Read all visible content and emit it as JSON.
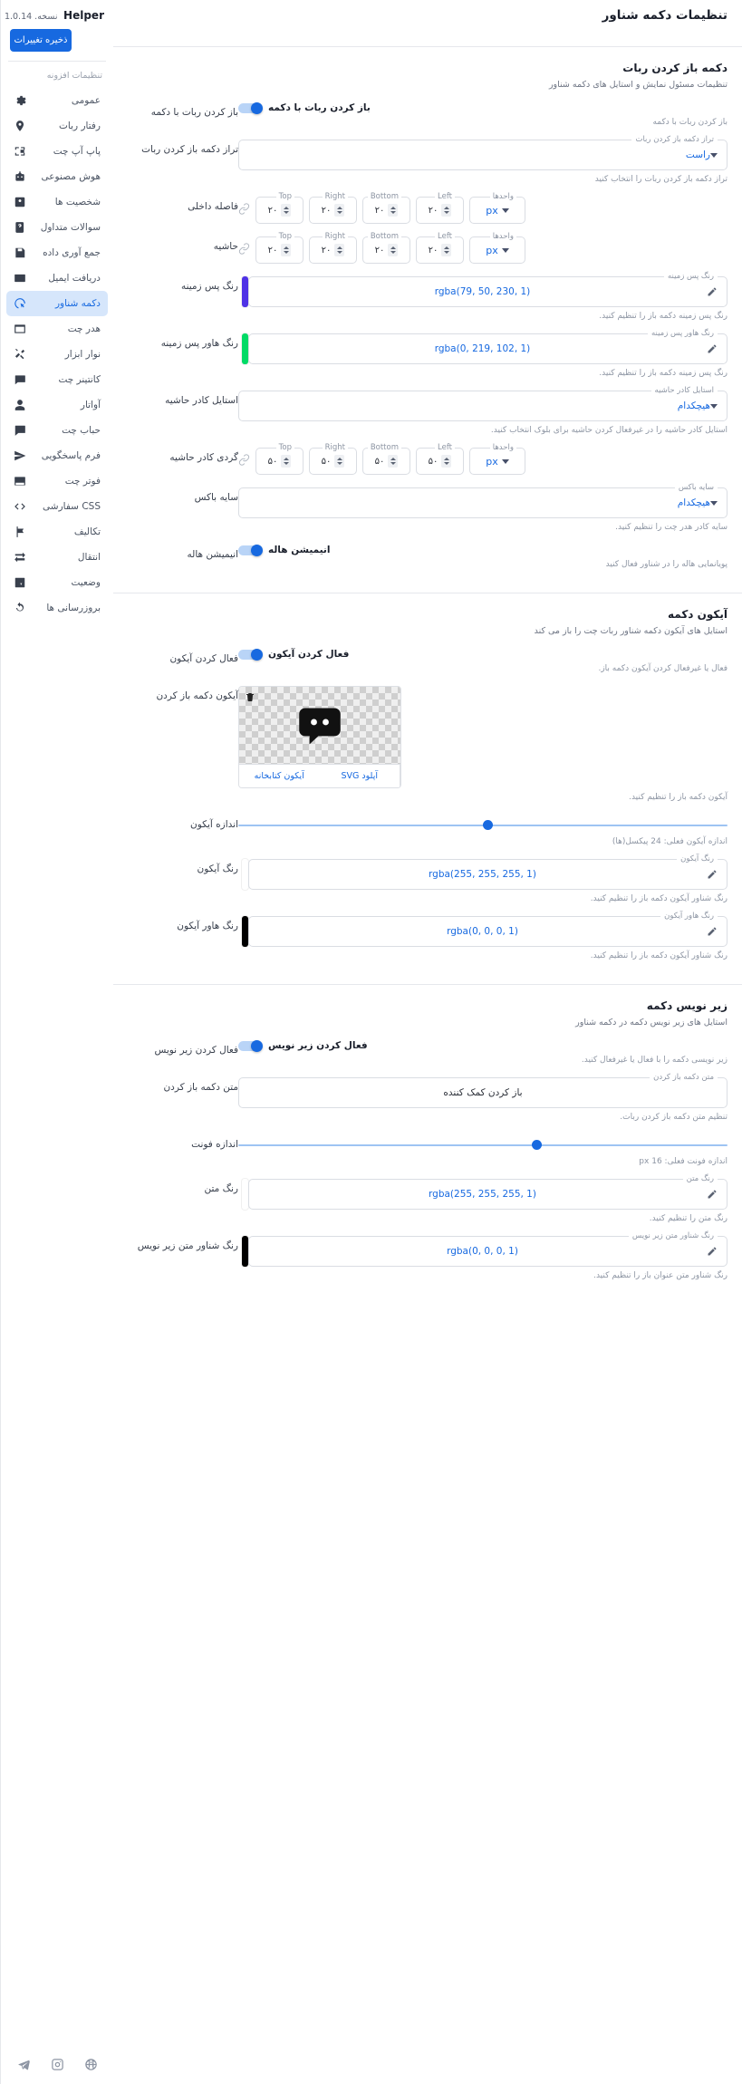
{
  "sidebar": {
    "brand": {
      "name": "Helper",
      "version": "نسخه. 1.0.14"
    },
    "save_label": "ذخیره تغییرات",
    "group_title": "تنظیمات افزونه",
    "items": [
      {
        "label": "عمومی",
        "icon": "gear-icon"
      },
      {
        "label": "رفتار ربات",
        "icon": "location-pin-icon"
      },
      {
        "label": "پاپ آپ چت",
        "icon": "popup-window-icon"
      },
      {
        "label": "هوش مصنوعی",
        "icon": "robot-icon"
      },
      {
        "label": "شخصیت ها",
        "icon": "contact-card-icon"
      },
      {
        "label": "سوالات متداول",
        "icon": "question-book-icon"
      },
      {
        "label": "جمع آوری داده",
        "icon": "save-disk-icon"
      },
      {
        "label": "دریافت ایمیل",
        "icon": "envelope-icon"
      },
      {
        "label": "دکمه شناور",
        "icon": "floating-button-icon",
        "active": true
      },
      {
        "label": "هدر چت",
        "icon": "window-icon"
      },
      {
        "label": "نوار ابزار",
        "icon": "tools-icon"
      },
      {
        "label": "کانتینر چت",
        "icon": "chat-container-icon"
      },
      {
        "label": "آواتار",
        "icon": "avatar-icon"
      },
      {
        "label": "حباب چت",
        "icon": "chat-bubble-icon"
      },
      {
        "label": "فرم پاسخگویی",
        "icon": "send-icon"
      },
      {
        "label": "فوتر چت",
        "icon": "footer-icon"
      },
      {
        "label": "CSS سفارشی",
        "icon": "code-icon"
      },
      {
        "label": "تکالیف",
        "icon": "flag-icon"
      },
      {
        "label": "انتقال",
        "icon": "transfer-icon"
      },
      {
        "label": "وضعیت",
        "icon": "status-icon"
      },
      {
        "label": "بروزرسانی ها",
        "icon": "refresh-icon"
      }
    ],
    "footer_icons": [
      "globe-icon",
      "instagram-icon",
      "telegram-icon"
    ]
  },
  "header": {
    "title": "تنظیمات دکمه شناور"
  },
  "sections": [
    {
      "title": "دکمه باز کردن ربات",
      "desc": "تنظیمات مسئول نمایش و استایل های دکمه شناور"
    },
    {
      "title": "آیکون دکمه",
      "desc": "استایل های آیکون دکمه شناور ربات چت را باز می کند"
    },
    {
      "title": "زیر نویس دکمه",
      "desc": "استایل های زیر نویس دکمه در دکمه شناور"
    }
  ],
  "s1": {
    "toggle_label": "باز کردن ربات با دکمه",
    "toggle_title": "باز کردن ربات با دکمه",
    "toggle_hint": "باز کردن ربات با دکمه",
    "align_label": "تراز دکمه باز کردن ربات",
    "align_legend": "تراز دکمه باز کردن ربات",
    "align_value": "راست",
    "align_hint": "تراز دکمه باز کردن ربات را انتخاب کنید",
    "padding_label": "فاصله داخلی",
    "margin_label": "حاشیه",
    "units_legend": "واحدها",
    "units_value": "px",
    "left_legend": "Left",
    "bottom_legend": "Bottom",
    "right_legend": "Right",
    "top_legend": "Top",
    "padding_values": {
      "left": "۲۰",
      "bottom": "۲۰",
      "right": "۲۰",
      "top": "۲۰"
    },
    "margin_values": {
      "left": "۲۰",
      "bottom": "۲۰",
      "right": "۲۰",
      "top": "۲۰"
    },
    "bg_label": "رنگ پس زمینه",
    "bg_legend": "رنگ پس زمینه",
    "bg_value": "rgba(79, 50, 230, 1)",
    "bg_swatch": "#4f32e6",
    "bg_hint": "رنگ پس زمینه دکمه باز را تنظیم کنید.",
    "hoverbg_label": "رنگ هاور پس زمینه",
    "hoverbg_legend": "رنگ هاور پس زمینه",
    "hoverbg_value": "rgba(0, 219, 102, 1)",
    "hoverbg_swatch": "#00db66",
    "hoverbg_hint": "رنگ پس زمینه دکمه باز را تنظیم کنید.",
    "borderstyle_label": "استایل کادر حاشیه",
    "borderstyle_legend": "استایل کادر حاشیه",
    "borderstyle_value": "هیچکدام",
    "borderstyle_hint": "استایل کادر حاشیه را در غیرفعال کردن حاشیه برای بلوک انتخاب کنید.",
    "radius_label": "گردی کادر حاشیه",
    "radius_values": {
      "left": "۵۰",
      "bottom": "۵۰",
      "right": "۵۰",
      "top": "۵۰"
    },
    "boxshadow_label": "سایه باکس",
    "boxshadow_legend": "سایه باکس",
    "boxshadow_value": "هیچکدام",
    "boxshadow_hint": "سایه کادر هدر چت را تنظیم کنید.",
    "halo_label": "انیمیشن هاله",
    "halo_title": "انیمیشن هاله",
    "halo_hint": "پویانمایی هاله را در شناور فعال کنید"
  },
  "s2": {
    "enable_label": "فعال کردن آیکون",
    "enable_title": "فعال کردن آیکون",
    "enable_hint": "فعال یا غیرفعال کردن آیکون دکمه باز.",
    "icon_label": "آیکون دکمه باز کردن",
    "btn_library": "آیکون کتابخانه",
    "btn_upload": "آپلود SVG",
    "icon_hint": "آیکون دکمه باز را تنظیم کنید.",
    "size_label": "اندازه آیکون",
    "size_hint": "اندازه آیکون فعلی: 24 پیکسل(ها)",
    "size_percent": 52,
    "color_label": "رنگ آیکون",
    "color_legend": "رنگ آیکون",
    "color_value": "rgba(255, 255, 255, 1)",
    "color_swatch": "#ffffff",
    "color_hint": "رنگ شناور آیکون دکمه باز را تنظیم کنید.",
    "hover_label": "رنگ هاور آیکون",
    "hover_legend": "رنگ هاور آیکون",
    "hover_value": "rgba(0, 0, 0, 1)",
    "hover_swatch": "#000000",
    "hover_hint": "رنگ شناور آیکون دکمه باز را تنظیم کنید."
  },
  "s3": {
    "enable_label": "فعال کردن زیر نویس",
    "enable_title": "فعال کردن زیر نویس",
    "enable_hint": "زیر نویسی دکمه را با فعال یا غیرفعال کنید.",
    "text_label": "متن دکمه باز کردن",
    "text_legend": "متن دکمه باز کردن",
    "text_value": "باز کردن کمک کننده",
    "text_hint": "تنظیم متن دکمه باز کردن ربات.",
    "font_label": "اندازه فونت",
    "font_hint": "اندازه فونت فعلی: 16 px",
    "font_percent": 62,
    "color_label": "رنگ متن",
    "color_legend": "رنگ متن",
    "color_value": "rgba(255, 255, 255, 1)",
    "color_swatch": "#ffffff",
    "color_hint": "رنگ متن را تنظیم کنید.",
    "subcolor_label": "رنگ شناور متن زیر نویس",
    "subcolor_legend": "رنگ شناور متن زیر نویس",
    "subcolor_value": "rgba(0, 0, 0, 1)",
    "subcolor_swatch": "#000000",
    "subcolor_hint": "رنگ شناور متن عنوان باز را تنظیم کنید."
  },
  "colors": {
    "accent": "#1769e0",
    "active_bg": "#d6e6fb",
    "border": "#dadde3"
  }
}
